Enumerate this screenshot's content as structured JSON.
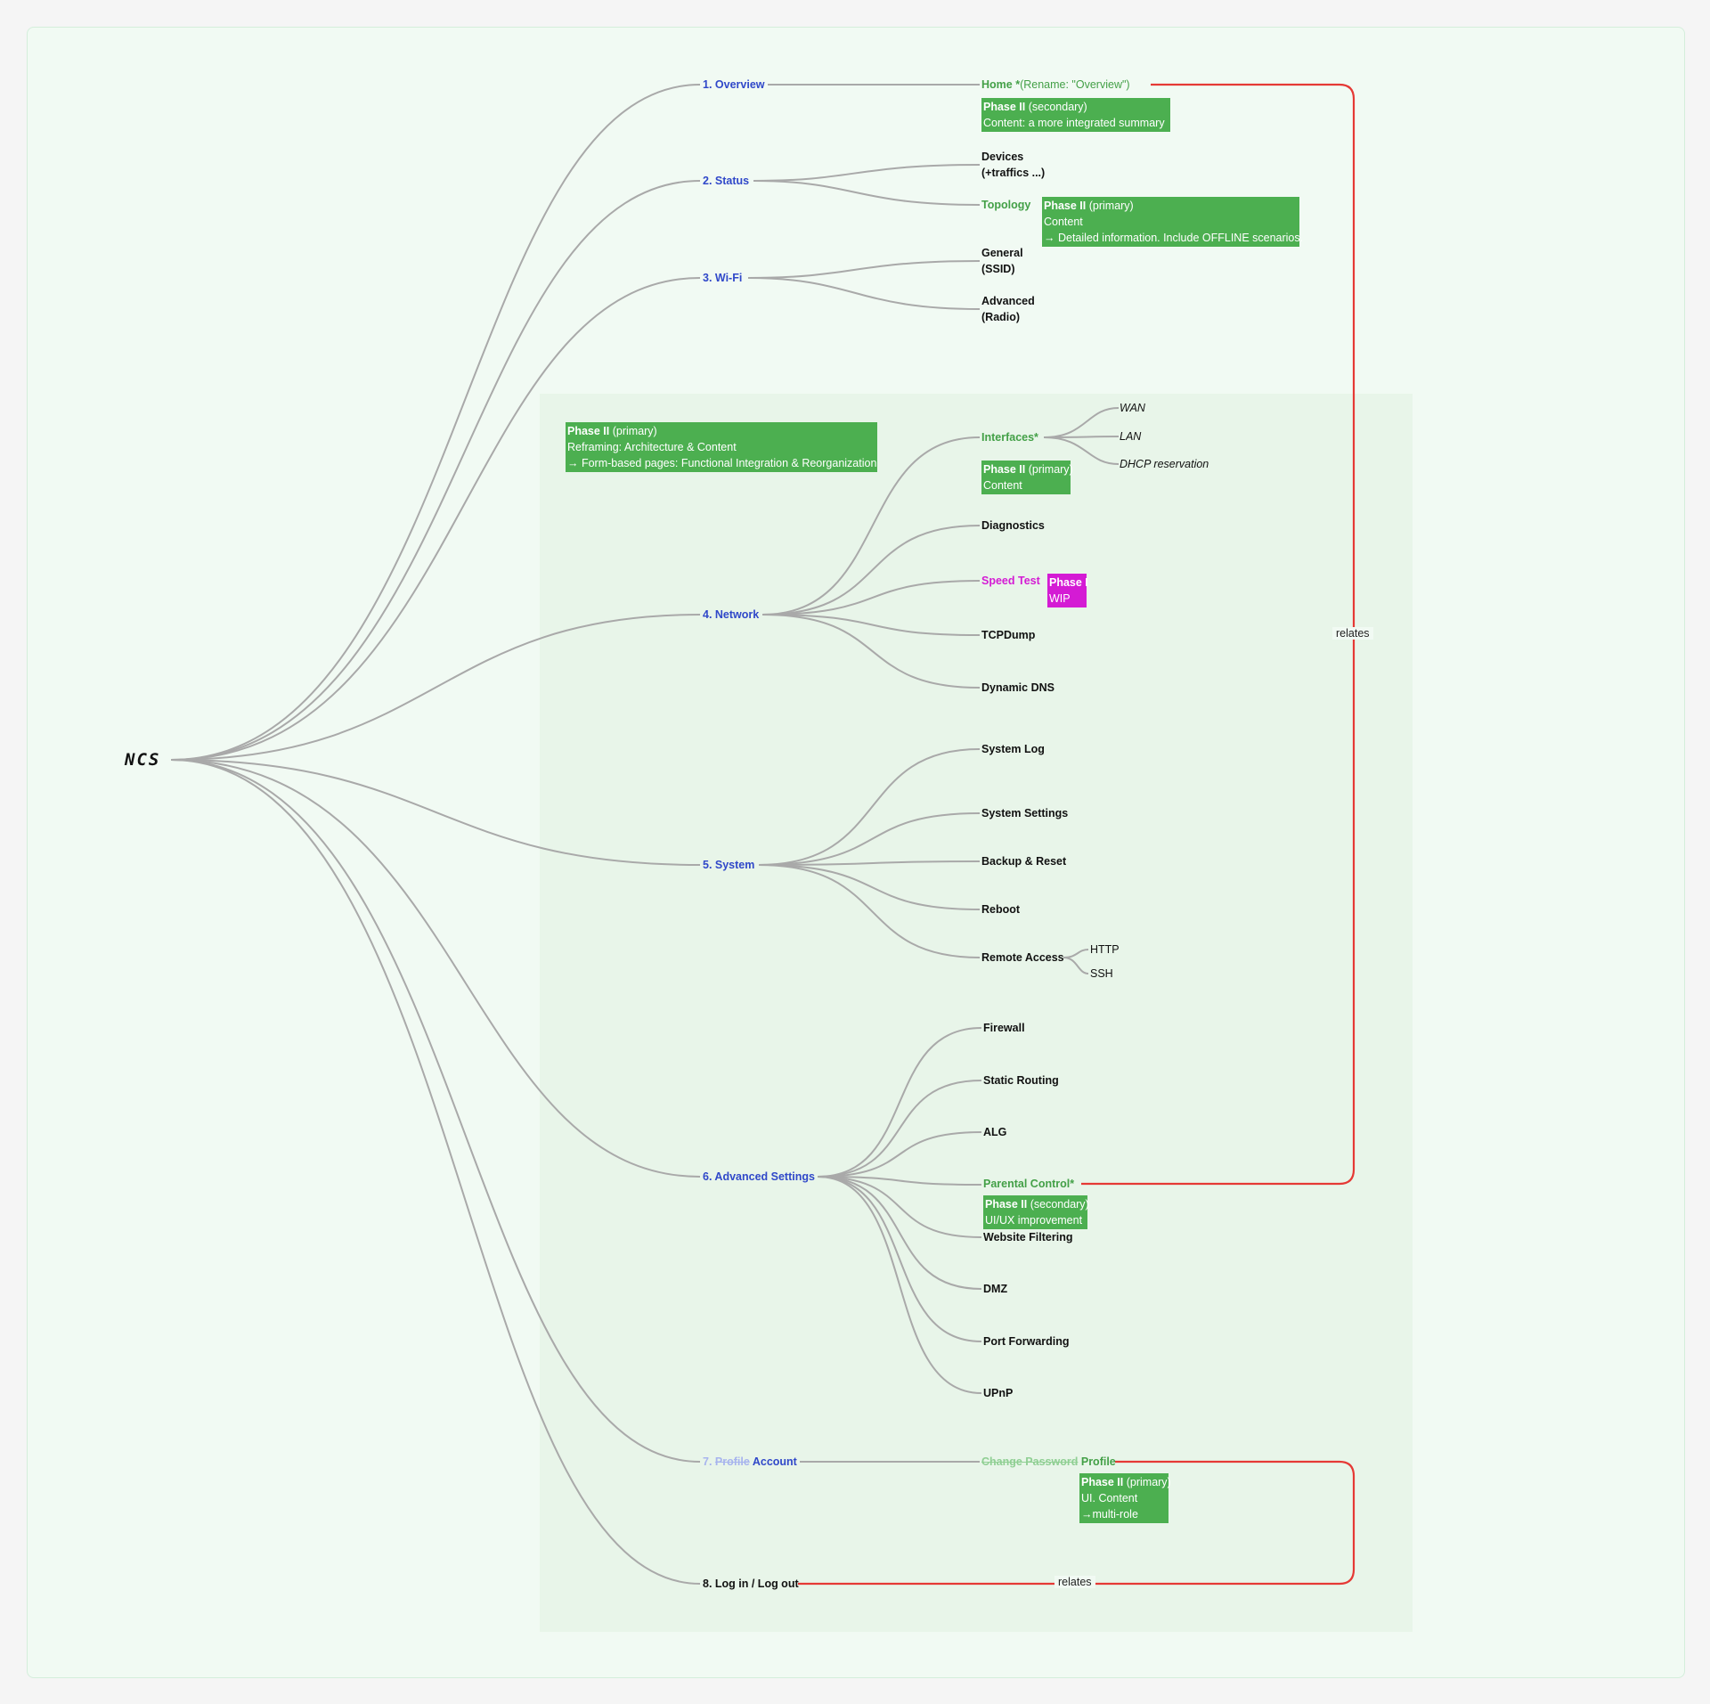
{
  "root": "NCS",
  "colors": {
    "category": "#3048c9",
    "highlight": "#43a047",
    "note_green": "#4caf50",
    "note_magenta": "#d41bd4",
    "relation": "#e53935",
    "link": "#a9a9a9"
  },
  "categories": {
    "overview": "1. Overview",
    "status": "2. Status",
    "wifi": "3. Wi-Fi",
    "network": "4. Network",
    "system": "5. System",
    "advanced": "6. Advanced Settings",
    "profile_num": "7.",
    "profile_old": "Profile",
    "profile_new": "Account",
    "login": "8. Log in / Log out"
  },
  "items": {
    "home": "Home *",
    "home_rename": "(Rename: \"Overview\")",
    "devices_1": "Devices",
    "devices_2": "(+traffics ...)",
    "topology": "Topology",
    "general_1": "General",
    "general_2": "(SSID)",
    "advanced_1": "Advanced",
    "advanced_2": "(Radio)",
    "interfaces": "Interfaces*",
    "wan": "WAN",
    "lan": "LAN",
    "dhcp": "DHCP reservation",
    "diagnostics": "Diagnostics",
    "speed_test": "Speed Test",
    "tcpdump": "TCPDump",
    "ddns": "Dynamic DNS",
    "syslog": "System Log",
    "syssettings": "System Settings",
    "backup": "Backup & Reset",
    "reboot": "Reboot",
    "remote": "Remote Access",
    "http": "HTTP",
    "ssh": "SSH",
    "firewall": "Firewall",
    "static_routing": "Static Routing",
    "alg": "ALG",
    "parental": "Parental Control*",
    "website": "Website Filtering",
    "dmz": "DMZ",
    "port_fwd": "Port Forwarding",
    "upnp": "UPnP",
    "change_pw": "Change Password",
    "profile_item": "Profile"
  },
  "notes": {
    "home": {
      "bold": "Phase II",
      "rest": " (secondary)",
      "lines": [
        "Content: a more integrated summary"
      ]
    },
    "topology": {
      "bold": "Phase II",
      "rest": " (primary)",
      "lines": [
        "Content",
        "→ Detailed information. Include OFFLINE scenarios."
      ]
    },
    "region": {
      "bold": "Phase II",
      "rest": " (primary)",
      "lines": [
        "Reframing: Architecture & Content",
        "→ Form-based pages: Functional Integration & Reorganization"
      ]
    },
    "interfaces": {
      "bold": "Phase II",
      "rest": " (primary)",
      "lines": [
        "Content"
      ]
    },
    "speed": {
      "bold": "Phase I",
      "rest": "",
      "lines": [
        "WIP"
      ]
    },
    "parental": {
      "bold": "Phase II",
      "rest": " (secondary)",
      "lines": [
        "UI/UX improvement"
      ]
    },
    "profile": {
      "bold": "Phase II",
      "rest": " (primary)",
      "lines": [
        "UI. Content",
        "→multi-role"
      ]
    }
  },
  "relations": {
    "label_1": "relates",
    "label_2": "relates"
  }
}
